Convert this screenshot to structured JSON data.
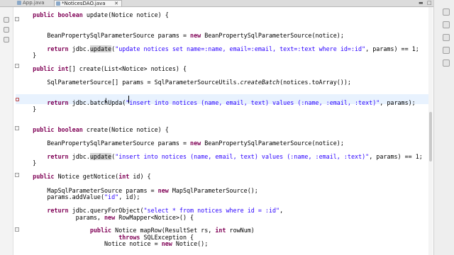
{
  "tabs": [
    {
      "label": "App.java",
      "active": false
    },
    {
      "label": "*NoticesDAO.java",
      "active": true
    }
  ],
  "tab_close": "✕",
  "window_controls": {
    "minimize": "▬",
    "maximize": "□"
  },
  "code_lines": [
    {
      "segs": [
        {
          "t": "    "
        },
        {
          "t": "public",
          "c": "kw"
        },
        {
          "t": " "
        },
        {
          "t": "boolean",
          "c": "kw"
        },
        {
          "t": " update(Notice notice) {"
        }
      ]
    },
    {
      "segs": [
        {
          "t": ""
        }
      ]
    },
    {
      "segs": [
        {
          "t": "        BeanPropertySqlParameterSource params = "
        },
        {
          "t": "new",
          "c": "kw"
        },
        {
          "t": " BeanPropertySqlParameterSource(notice);"
        }
      ]
    },
    {
      "segs": [
        {
          "t": ""
        }
      ]
    },
    {
      "segs": [
        {
          "t": "        "
        },
        {
          "t": "return",
          "c": "kw"
        },
        {
          "t": " jdbc."
        },
        {
          "t": "update",
          "c": "mhl"
        },
        {
          "t": "("
        },
        {
          "t": "\"update notices set name=:name, email=:email, text=:text where id=:id\"",
          "c": "str"
        },
        {
          "t": ", params) == 1;"
        }
      ]
    },
    {
      "segs": [
        {
          "t": "    }"
        }
      ]
    },
    {
      "segs": [
        {
          "t": ""
        }
      ]
    },
    {
      "segs": [
        {
          "t": "    "
        },
        {
          "t": "public",
          "c": "kw"
        },
        {
          "t": " "
        },
        {
          "t": "int",
          "c": "kw"
        },
        {
          "t": "[] create(List<Notice> notices) {"
        }
      ]
    },
    {
      "segs": [
        {
          "t": ""
        }
      ]
    },
    {
      "segs": [
        {
          "t": "        SqlParameterSource[] params = SqlParameterSourceUtils."
        },
        {
          "t": "createBatch",
          "c": "it"
        },
        {
          "t": "(notices.toArray());"
        }
      ]
    },
    {
      "segs": [
        {
          "t": ""
        }
      ]
    },
    {
      "segs": [
        {
          "t": ""
        }
      ]
    },
    {
      "segs": [
        {
          "t": "        "
        },
        {
          "t": "return",
          "c": "kw"
        },
        {
          "t": " jdbc.batchUpda("
        },
        {
          "t": "\"insert into notices (name, email, text) values (:name, :email, :text)\"",
          "c": "str"
        },
        {
          "t": ", params);"
        }
      ]
    },
    {
      "segs": [
        {
          "t": "    }"
        }
      ]
    },
    {
      "segs": [
        {
          "t": ""
        }
      ]
    },
    {
      "segs": [
        {
          "t": ""
        }
      ]
    },
    {
      "segs": [
        {
          "t": "    "
        },
        {
          "t": "public",
          "c": "kw"
        },
        {
          "t": " "
        },
        {
          "t": "boolean",
          "c": "kw"
        },
        {
          "t": " create(Notice notice) {"
        }
      ]
    },
    {
      "segs": [
        {
          "t": ""
        }
      ]
    },
    {
      "segs": [
        {
          "t": "        BeanPropertySqlParameterSource params = "
        },
        {
          "t": "new",
          "c": "kw"
        },
        {
          "t": " BeanPropertySqlParameterSource(notice);"
        }
      ]
    },
    {
      "segs": [
        {
          "t": ""
        }
      ]
    },
    {
      "segs": [
        {
          "t": "        "
        },
        {
          "t": "return",
          "c": "kw"
        },
        {
          "t": " jdbc."
        },
        {
          "t": "update",
          "c": "mhl"
        },
        {
          "t": "("
        },
        {
          "t": "\"insert into notices (name, email, text) values (:name, :email, :text)\"",
          "c": "str"
        },
        {
          "t": ", params) == 1;"
        }
      ]
    },
    {
      "segs": [
        {
          "t": "    }"
        }
      ]
    },
    {
      "segs": [
        {
          "t": ""
        }
      ]
    },
    {
      "segs": [
        {
          "t": "    "
        },
        {
          "t": "public",
          "c": "kw"
        },
        {
          "t": " Notice getNotice("
        },
        {
          "t": "int",
          "c": "kw"
        },
        {
          "t": " id) {"
        }
      ]
    },
    {
      "segs": [
        {
          "t": ""
        }
      ]
    },
    {
      "segs": [
        {
          "t": "        MapSqlParameterSource params = "
        },
        {
          "t": "new",
          "c": "kw"
        },
        {
          "t": " MapSqlParameterSource();"
        }
      ]
    },
    {
      "segs": [
        {
          "t": "        params.addValue("
        },
        {
          "t": "\"id\"",
          "c": "str"
        },
        {
          "t": ", id);"
        }
      ]
    },
    {
      "segs": [
        {
          "t": ""
        }
      ]
    },
    {
      "segs": [
        {
          "t": "        "
        },
        {
          "t": "return",
          "c": "kw"
        },
        {
          "t": " jdbc.queryForObject("
        },
        {
          "t": "\"select * from notices where id = :id\"",
          "c": "str"
        },
        {
          "t": ","
        }
      ]
    },
    {
      "segs": [
        {
          "t": "                params, "
        },
        {
          "t": "new",
          "c": "kw"
        },
        {
          "t": " RowMapper<Notice>() {"
        }
      ]
    },
    {
      "segs": [
        {
          "t": ""
        }
      ]
    },
    {
      "segs": [
        {
          "t": "                    "
        },
        {
          "t": "public",
          "c": "kw"
        },
        {
          "t": " Notice mapRow(ResultSet rs, "
        },
        {
          "t": "int",
          "c": "kw"
        },
        {
          "t": " rowNum)"
        }
      ]
    },
    {
      "segs": [
        {
          "t": "                            "
        },
        {
          "t": "throws",
          "c": "kw"
        },
        {
          "t": " SQLException {"
        }
      ]
    },
    {
      "segs": [
        {
          "t": "                        Notice notice = "
        },
        {
          "t": "new",
          "c": "kw"
        },
        {
          "t": " Notice();"
        }
      ]
    }
  ],
  "colors": {
    "keyword": "#7f0055",
    "string": "#2a00ff",
    "current_line": "#e8f2fe"
  }
}
